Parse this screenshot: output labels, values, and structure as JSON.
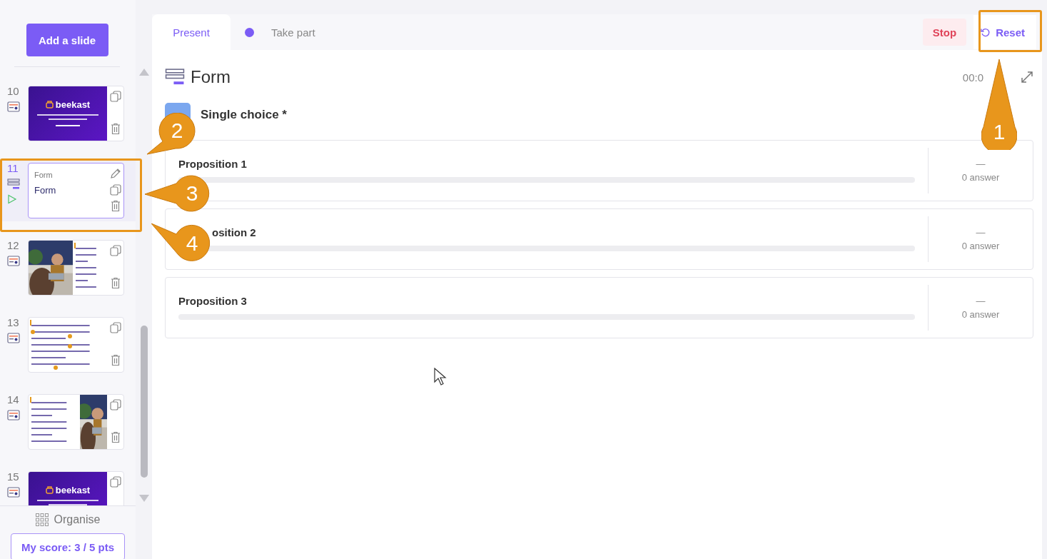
{
  "sidebar": {
    "add_button": "Add a slide",
    "slides": [
      {
        "number": "10",
        "kind": "brand",
        "selected": false,
        "playing": false,
        "logo": "beekast"
      },
      {
        "number": "11",
        "kind": "form",
        "selected": true,
        "playing": true,
        "label": "Form",
        "title": "Form"
      },
      {
        "number": "12",
        "kind": "photo-left",
        "selected": false,
        "playing": false
      },
      {
        "number": "13",
        "kind": "doc",
        "selected": false,
        "playing": false
      },
      {
        "number": "14",
        "kind": "photo-right",
        "selected": false,
        "playing": false
      },
      {
        "number": "15",
        "kind": "brand",
        "selected": false,
        "playing": false,
        "logo": "beekast"
      }
    ],
    "organise": "Organise",
    "score_button": "My score: 3 / 5 pts"
  },
  "tabs": [
    {
      "label": "Present",
      "selected": true,
      "live": false
    },
    {
      "label": "Take part",
      "selected": false,
      "live": true
    }
  ],
  "actions": {
    "stop": "Stop",
    "reset": "Reset"
  },
  "activity": {
    "title": "Form",
    "timer": "00:0",
    "question": "Single choice *",
    "propositions": [
      {
        "label": "Proposition 1",
        "level": 0,
        "result": "—",
        "answers": "0 answer"
      },
      {
        "label": "osition 2",
        "kind": "covered",
        "level": 0,
        "result": "—",
        "answers": "0 answer"
      },
      {
        "label": "Proposition 3",
        "level": 0,
        "result": "—",
        "answers": "0 answer"
      }
    ]
  },
  "annotations": [
    {
      "number": "1",
      "kind": "up"
    },
    {
      "number": "2",
      "kind": "down-left"
    },
    {
      "number": "3",
      "kind": "left"
    },
    {
      "number": "4",
      "kind": "up-left"
    }
  ]
}
